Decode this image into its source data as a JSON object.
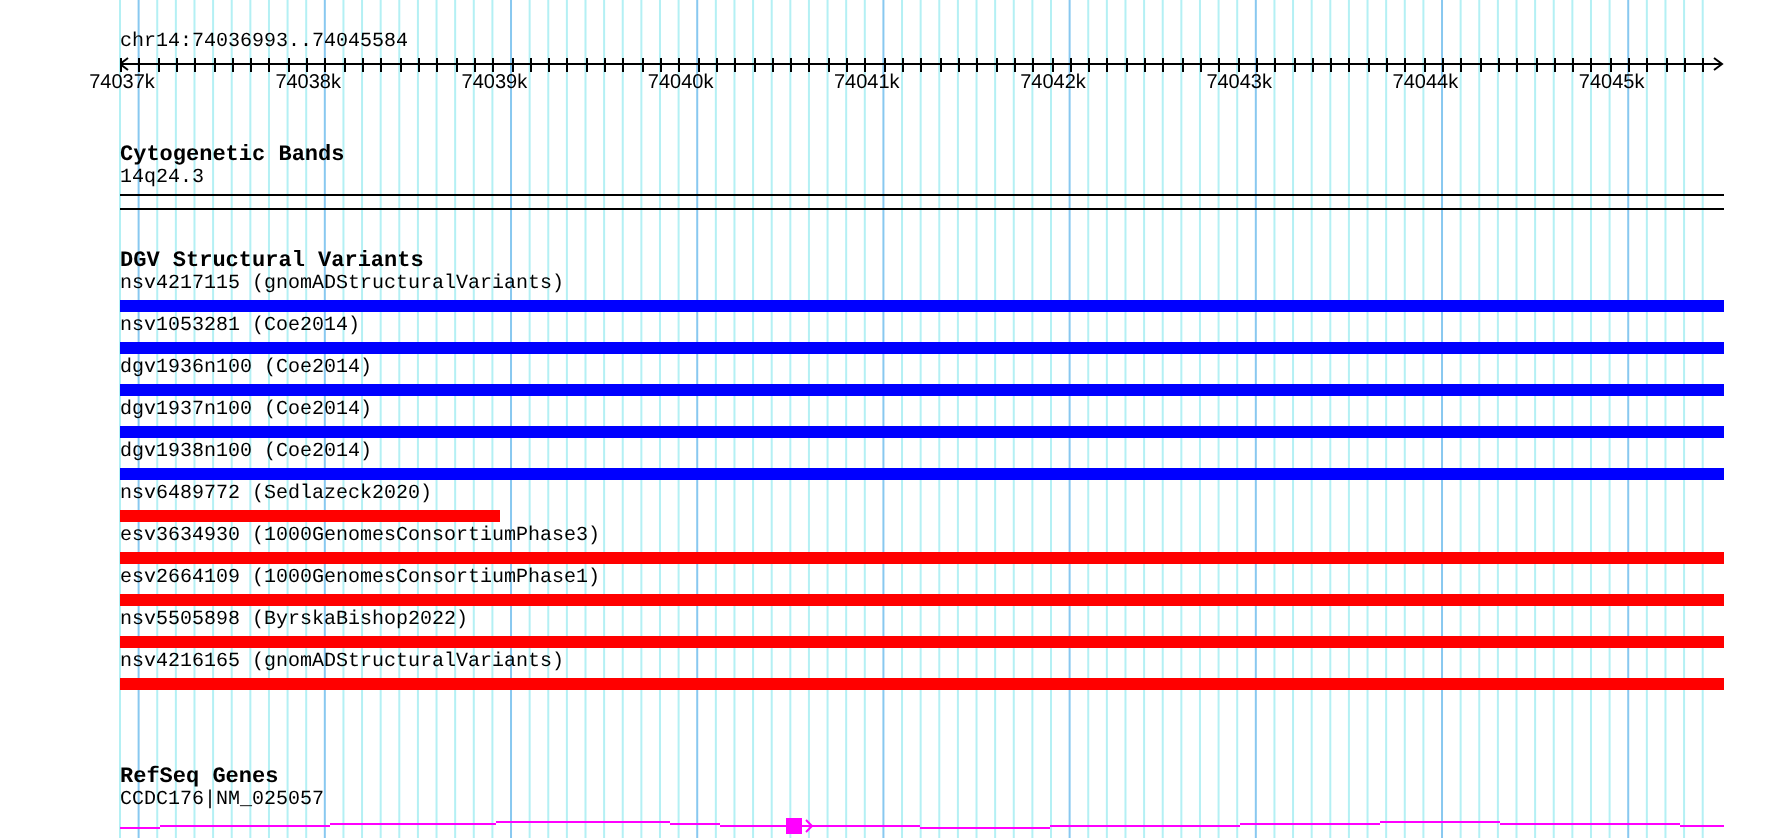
{
  "location": "chr14:74036993..74045584",
  "ruler": {
    "ticks": [
      "74037k",
      "74038k",
      "74039k",
      "74040k",
      "74041k",
      "74042k",
      "74043k",
      "74044k",
      "74045k"
    ]
  },
  "tracks": [
    {
      "kind": "bands",
      "title": "Cytogenetic Bands",
      "items": [
        {
          "label": "14q24.3"
        }
      ]
    },
    {
      "kind": "variants",
      "title": "DGV Structural Variants",
      "items": [
        {
          "label": "nsv4217115 (gnomADStructuralVariants)",
          "color": "#0000ff"
        },
        {
          "label": "nsv1053281 (Coe2014)",
          "color": "#0000ff"
        },
        {
          "label": "dgv1936n100 (Coe2014)",
          "color": "#0000ff"
        },
        {
          "label": "dgv1937n100 (Coe2014)",
          "color": "#0000ff"
        },
        {
          "label": "dgv1938n100 (Coe2014)",
          "color": "#0000ff"
        },
        {
          "label": "nsv6489772 (Sedlazeck2020)",
          "color": "#ff0000"
        },
        {
          "label": "esv3634930 (1000GenomesConsortiumPhase3)",
          "color": "#ff0000"
        },
        {
          "label": "esv2664109 (1000GenomesConsortiumPhase1)",
          "color": "#ff0000"
        },
        {
          "label": "nsv5505898 (ByrskaBishop2022)",
          "color": "#ff0000"
        },
        {
          "label": "nsv4216165 (gnomADStructuralVariants)",
          "color": "#ff0000"
        }
      ]
    },
    {
      "kind": "genes",
      "title": "RefSeq Genes",
      "items": [
        {
          "label": "CCDC176|NM_025057"
        }
      ]
    }
  ]
}
